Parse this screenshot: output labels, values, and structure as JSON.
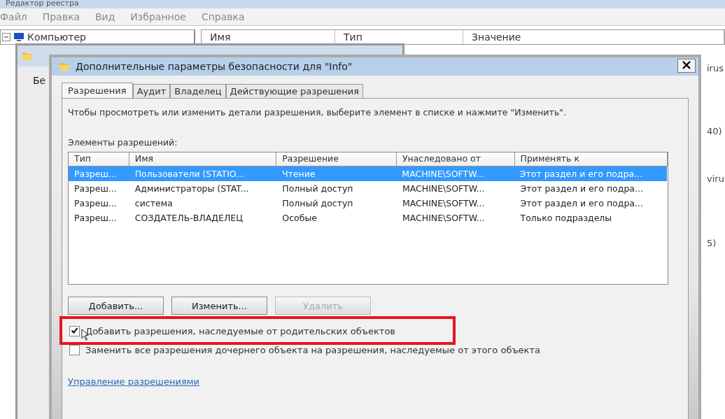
{
  "background_window": {
    "title": "Редактор реестра",
    "menu": [
      "Файл",
      "Правка",
      "Вид",
      "Избранное",
      "Справка"
    ],
    "tree": {
      "root": "Компьютер",
      "expanded": true
    },
    "list_columns": [
      "Имя",
      "Тип",
      "Значение"
    ],
    "value_fragments": [
      "irus",
      "40)",
      "viru",
      "5)"
    ]
  },
  "middle_window": {
    "fragment": "Бе"
  },
  "dialog": {
    "title": "Дополнительные параметры безопасности  для \"Info\"",
    "tabs": [
      {
        "label": "Разрешения",
        "selected": true
      },
      {
        "label": "Аудит",
        "selected": false
      },
      {
        "label": "Владелец",
        "selected": false
      },
      {
        "label": "Действующие разрешения",
        "selected": false
      }
    ],
    "description": "Чтобы просмотреть или изменить детали разрешения, выберите элемент в списке и нажмите \"Изменить\".",
    "list_label": "Элементы разрешений:",
    "table": {
      "columns": [
        "Тип",
        "Имя",
        "Разрешение",
        "Унаследовано от",
        "Применять к"
      ],
      "rows": [
        {
          "cells": [
            "Разреш...",
            "Пользователи (STATIO...",
            "Чтение",
            "MACHINE\\SOFTW...",
            "Этот раздел и его подра..."
          ],
          "selected": true
        },
        {
          "cells": [
            "Разреш...",
            "Администраторы (STAT...",
            "Полный доступ",
            "MACHINE\\SOFTW...",
            "Этот раздел и его подра..."
          ],
          "selected": false
        },
        {
          "cells": [
            "Разреш...",
            "система",
            "Полный доступ",
            "MACHINE\\SOFTW...",
            "Этот раздел и его подра..."
          ],
          "selected": false
        },
        {
          "cells": [
            "Разреш...",
            "СОЗДАТЕЛЬ-ВЛАДЕЛЕЦ",
            "Особые",
            "MACHINE\\SOFTW...",
            "Только подразделы"
          ],
          "selected": false
        }
      ]
    },
    "buttons": [
      {
        "label": "Добавить...",
        "disabled": false
      },
      {
        "label": "Изменить...",
        "disabled": false
      },
      {
        "label": "Удалить",
        "disabled": true
      }
    ],
    "checkboxes": [
      {
        "label": "Добавить разрешения, наследуемые от родительских объектов",
        "checked": true,
        "highlighted": true
      },
      {
        "label": "Заменить все разрешения дочернего объекта на разрешения, наследуемые от этого объекта",
        "checked": false,
        "highlighted": false
      }
    ],
    "link": "Управление разрешениями"
  }
}
